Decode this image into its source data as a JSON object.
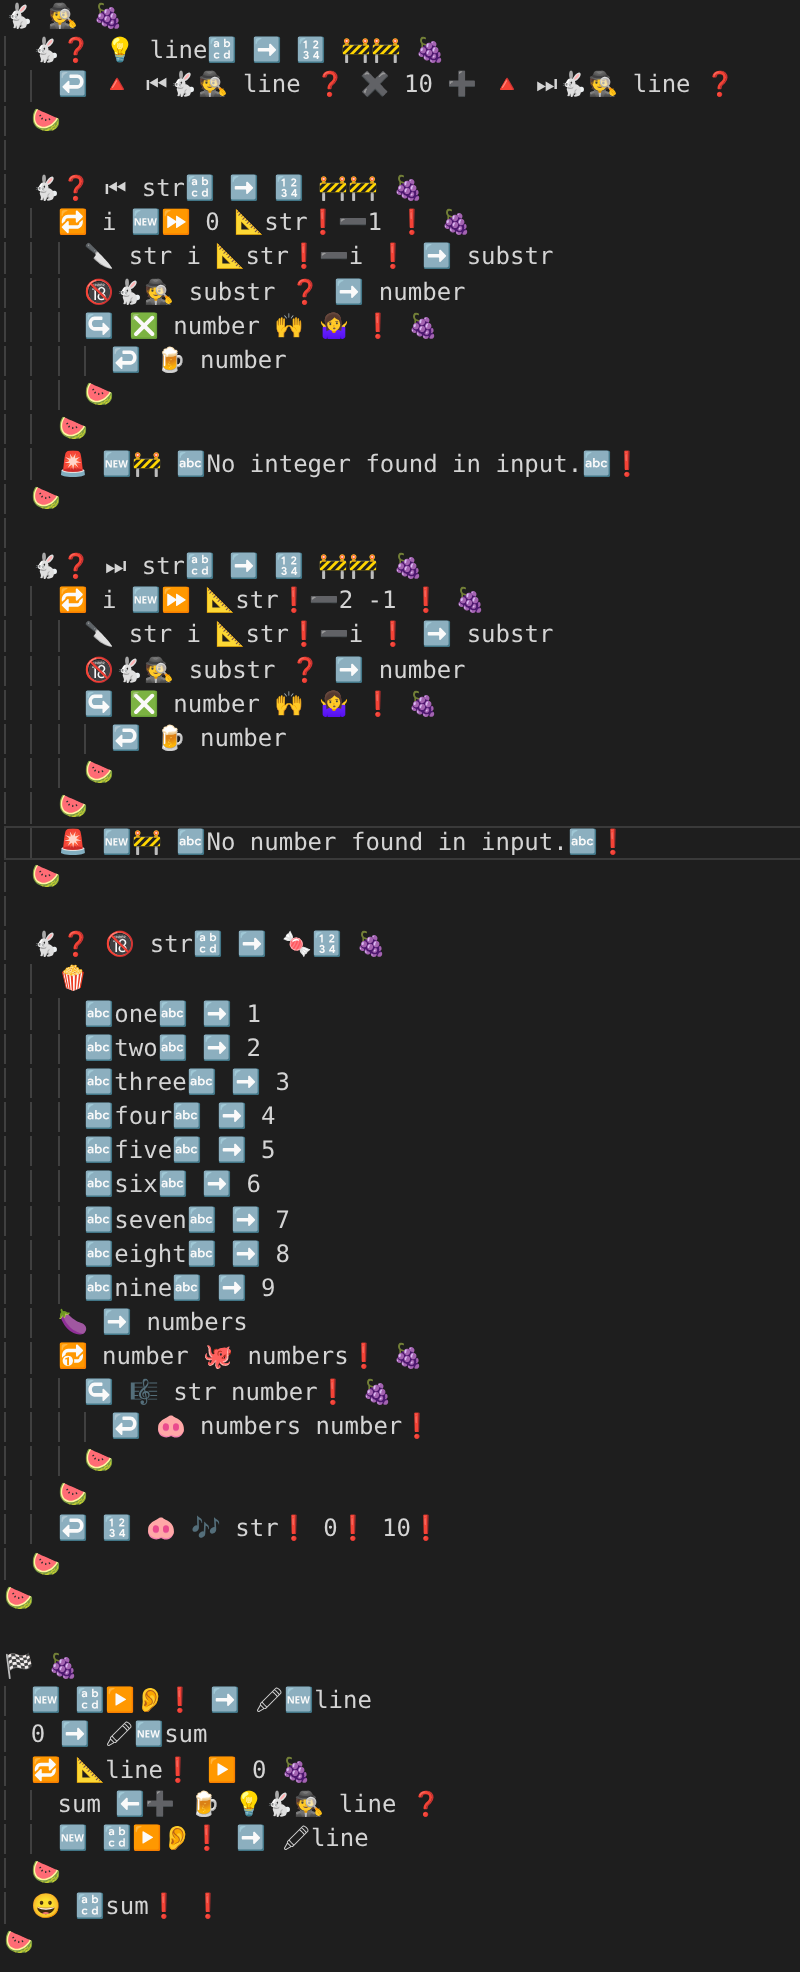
{
  "editor": {
    "lines": [
      {
        "kind": "code",
        "current": false,
        "text": "🐇 🕵️ 🍇",
        "end": "🍉",
        "children": [
          {
            "kind": "code",
            "current": false,
            "text": "🐇❓ 💡 line🔡 ➡️ 🔢 🚧🚧 🍇",
            "end": "🍉",
            "children": [
              {
                "kind": "code",
                "current": false,
                "text": "↩️ 🔺 ⏮🐇🕵️ line ❓ ✖️ 10 ➕ 🔺 ⏭🐇🕵️ line ❓"
              }
            ]
          },
          {
            "kind": "blank"
          },
          {
            "kind": "code",
            "current": false,
            "text": "🐇❓ ⏮ str🔡 ➡️ 🔢 🚧🚧 🍇",
            "end": "🍉",
            "children": [
              {
                "kind": "code",
                "current": false,
                "text": "🔁 i 🆕⏩ 0 📐str❗➖1 ❗ 🍇",
                "end": "🍉",
                "children": [
                  {
                    "kind": "code",
                    "current": false,
                    "text": "🔪 str i 📐str❗➖i ❗ ➡️ substr"
                  },
                  {
                    "kind": "code",
                    "current": false,
                    "text": "🔞🐇🕵️ substr ❓ ➡️ number"
                  },
                  {
                    "kind": "code",
                    "current": false,
                    "text": "↪️ ❎ number 🙌 🤷‍♀️ ❗ 🍇",
                    "end": "🍉",
                    "children": [
                      {
                        "kind": "code",
                        "current": false,
                        "text": "↩️ 🍺 number"
                      }
                    ]
                  }
                ]
              },
              {
                "kind": "code",
                "current": false,
                "text": "🚨 🆕🚧 🔤No integer found in input.🔤❗"
              }
            ]
          },
          {
            "kind": "blank"
          },
          {
            "kind": "code",
            "current": false,
            "text": "🐇❓ ⏭ str🔡 ➡️ 🔢 🚧🚧 🍇",
            "end": "🍉",
            "children": [
              {
                "kind": "code",
                "current": false,
                "text": "🔁 i 🆕⏩ 📐str❗➖2 -1 ❗ 🍇",
                "end": "🍉",
                "children": [
                  {
                    "kind": "code",
                    "current": false,
                    "text": "🔪 str i 📐str❗➖i ❗ ➡️ substr"
                  },
                  {
                    "kind": "code",
                    "current": false,
                    "text": "🔞🐇🕵️ substr ❓ ➡️ number"
                  },
                  {
                    "kind": "code",
                    "current": false,
                    "text": "↪️ ❎ number 🙌 🤷‍♀️ ❗ 🍇",
                    "end": "🍉",
                    "children": [
                      {
                        "kind": "code",
                        "current": false,
                        "text": "↩️ 🍺 number"
                      }
                    ]
                  }
                ]
              },
              {
                "kind": "code",
                "current": true,
                "text": "🚨 🆕🚧 🔤No number found in input.🔤❗"
              }
            ]
          },
          {
            "kind": "blank"
          },
          {
            "kind": "code",
            "current": false,
            "text": "🐇❓ 🔞 str🔡 ➡️ 🍬🔢 🍇",
            "end": "🍉",
            "children": [
              {
                "kind": "code",
                "current": false,
                "text": "🍿",
                "end": "🍆 ➡️ numbers",
                "children": [
                  {
                    "kind": "code",
                    "current": false,
                    "text": "🔤one🔤 ➡️ 1"
                  },
                  {
                    "kind": "code",
                    "current": false,
                    "text": "🔤two🔤 ➡️ 2"
                  },
                  {
                    "kind": "code",
                    "current": false,
                    "text": "🔤three🔤 ➡️ 3"
                  },
                  {
                    "kind": "code",
                    "current": false,
                    "text": "🔤four🔤 ➡️ 4"
                  },
                  {
                    "kind": "code",
                    "current": false,
                    "text": "🔤five🔤 ➡️ 5"
                  },
                  {
                    "kind": "code",
                    "current": false,
                    "text": "🔤six🔤 ➡️ 6"
                  },
                  {
                    "kind": "code",
                    "current": false,
                    "text": "🔤seven🔤 ➡️ 7"
                  },
                  {
                    "kind": "code",
                    "current": false,
                    "text": "🔤eight🔤 ➡️ 8"
                  },
                  {
                    "kind": "code",
                    "current": false,
                    "text": "🔤nine🔤 ➡️ 9"
                  }
                ]
              },
              {
                "kind": "code",
                "current": false,
                "text": "🔂 number 🐙 numbers❗ 🍇",
                "end": "🍉",
                "children": [
                  {
                    "kind": "code",
                    "current": false,
                    "text": "↪️ 🎼 str number❗ 🍇",
                    "end": "🍉",
                    "children": [
                      {
                        "kind": "code",
                        "current": false,
                        "text": "↩️ 🐽 numbers number❗"
                      }
                    ]
                  }
                ]
              },
              {
                "kind": "code",
                "current": false,
                "text": "↩️ 🔢 🐽 🎶 str❗ 0❗ 10❗"
              }
            ]
          }
        ]
      },
      {
        "kind": "blank"
      },
      {
        "kind": "code",
        "current": false,
        "text": "🏁 🍇",
        "end": "🍉",
        "children": [
          {
            "kind": "code",
            "current": false,
            "text": "🆕 🔡▶️👂❗ ➡️ 🖍🆕line"
          },
          {
            "kind": "code",
            "current": false,
            "text": "0 ➡️ 🖍🆕sum"
          },
          {
            "kind": "code",
            "current": false,
            "text": "🔁 📐line❗ ▶️ 0 🍇",
            "end": "🍉",
            "children": [
              {
                "kind": "code",
                "current": false,
                "text": "sum ⬅️➕ 🍺 💡🐇🕵️ line ❓"
              },
              {
                "kind": "code",
                "current": false,
                "text": "🆕 🔡▶️👂❗ ➡️ 🖍line"
              }
            ]
          },
          {
            "kind": "code",
            "current": false,
            "text": "😀 🔡sum❗ ❗"
          }
        ]
      }
    ]
  }
}
